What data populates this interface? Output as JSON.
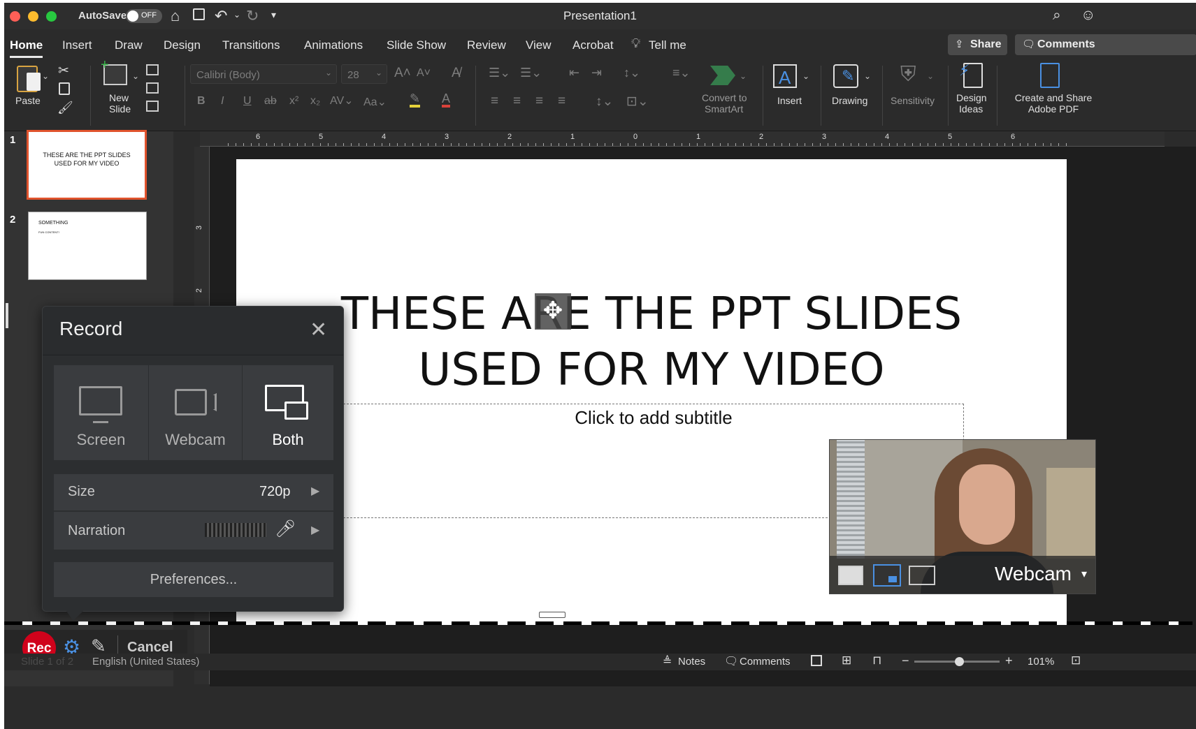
{
  "window": {
    "title": "Presentation1",
    "autosave_label": "AutoSave",
    "autosave_state": "OFF"
  },
  "tabs": [
    "Home",
    "Insert",
    "Draw",
    "Design",
    "Transitions",
    "Animations",
    "Slide Show",
    "Review",
    "View",
    "Acrobat"
  ],
  "tell_me": "Tell me",
  "share_label": "Share",
  "comments_label": "Comments",
  "ribbon": {
    "paste": "Paste",
    "new_slide_1": "New",
    "new_slide_2": "Slide",
    "font_name": "Calibri (Body)",
    "font_size": "28",
    "convert_1": "Convert to",
    "convert_2": "SmartArt",
    "insert": "Insert",
    "drawing": "Drawing",
    "sensitivity": "Sensitivity",
    "design_ideas_1": "Design",
    "design_ideas_2": "Ideas",
    "adobe_1": "Create and Share",
    "adobe_2": "Adobe PDF"
  },
  "thumbnails": [
    {
      "number": "1",
      "line1": "THESE ARE THE PPT SLIDES",
      "line2": "USED FOR MY VIDEO"
    },
    {
      "number": "2",
      "title": "SOMETHING",
      "body": "FUN CONTENT!"
    }
  ],
  "slide": {
    "title_line1": "THESE ARE THE PPT SLIDES",
    "title_line2": "USED FOR MY VIDEO",
    "subtitle_placeholder": "Click to add subtitle"
  },
  "ruler_labels": [
    "6",
    "5",
    "4",
    "3",
    "2",
    "1",
    "0",
    "1",
    "2",
    "3",
    "4",
    "5",
    "6"
  ],
  "vruler_labels": [
    "3",
    "2"
  ],
  "record_panel": {
    "title": "Record",
    "modes": [
      "Screen",
      "Webcam",
      "Both"
    ],
    "selected_mode": "Both",
    "size_label": "Size",
    "size_value": "720p",
    "narration_label": "Narration",
    "preferences": "Preferences..."
  },
  "webcam_overlay": {
    "label": "Webcam"
  },
  "recorder_bar": {
    "rec": "Rec",
    "cancel": "Cancel"
  },
  "statusbar": {
    "slide_info": "Slide 1 of 2",
    "language": "English (United States)",
    "notes": "Notes",
    "comments": "Comments",
    "zoom": "101%"
  },
  "colors": {
    "rec_red": "#d0021b",
    "accent_blue": "#4a90e2",
    "selected_thumb": "#e0532d"
  }
}
